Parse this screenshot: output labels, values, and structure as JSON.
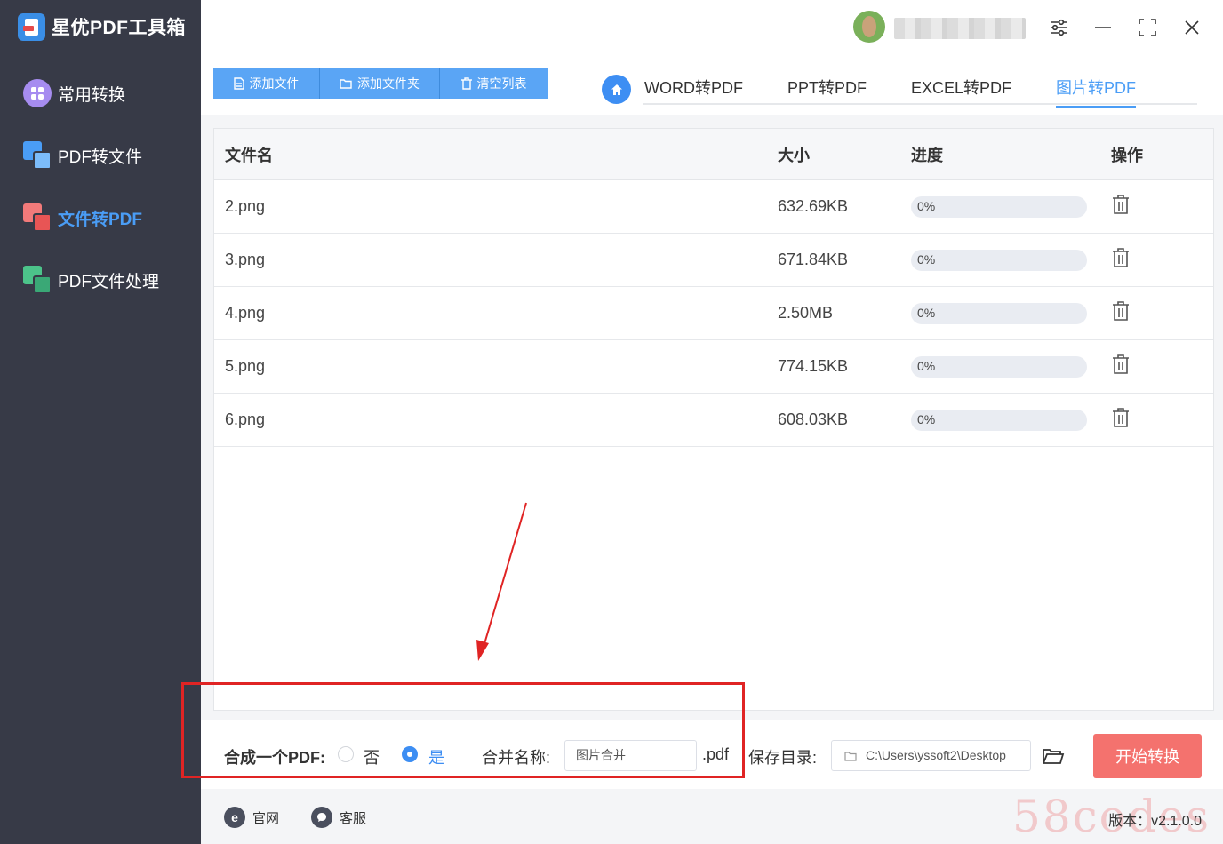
{
  "app": {
    "title": "星优PDF工具箱"
  },
  "sidebar": {
    "items": [
      {
        "label": "常用转换",
        "active": false
      },
      {
        "label": "PDF转文件",
        "active": false
      },
      {
        "label": "文件转PDF",
        "active": true
      },
      {
        "label": "PDF文件处理",
        "active": false
      }
    ]
  },
  "user": {
    "name": ""
  },
  "toolbar": {
    "add_file": "添加文件",
    "add_folder": "添加文件夹",
    "clear_list": "清空列表"
  },
  "tabs": [
    {
      "label": "WORD转PDF",
      "active": false
    },
    {
      "label": "PPT转PDF",
      "active": false
    },
    {
      "label": "EXCEL转PDF",
      "active": false
    },
    {
      "label": "图片转PDF",
      "active": true
    }
  ],
  "table": {
    "headers": {
      "name": "文件名",
      "size": "大小",
      "progress": "进度",
      "action": "操作"
    },
    "rows": [
      {
        "name": "2.png",
        "size": "632.69KB",
        "progress": "0%",
        "progress_value": 0
      },
      {
        "name": "3.png",
        "size": "671.84KB",
        "progress": "0%",
        "progress_value": 0
      },
      {
        "name": "4.png",
        "size": "2.50MB",
        "progress": "0%",
        "progress_value": 0
      },
      {
        "name": "5.png",
        "size": "774.15KB",
        "progress": "0%",
        "progress_value": 0
      },
      {
        "name": "6.png",
        "size": "608.03KB",
        "progress": "0%",
        "progress_value": 0
      }
    ]
  },
  "options": {
    "merge_label": "合成一个PDF:",
    "no_label": "否",
    "yes_label": "是",
    "merge_selected": "是",
    "merge_name_label": "合并名称:",
    "merge_name_value": "图片合并",
    "ext": ".pdf",
    "save_dir_label": "保存目录:",
    "save_dir_value": "C:\\Users\\yssoft2\\Desktop",
    "start_label": "开始转换"
  },
  "footer": {
    "website": "官网",
    "support": "客服",
    "version": "版本：v2.1.0.0",
    "watermark": "58codes"
  },
  "colors": {
    "sidebar_bg": "#373a47",
    "accent": "#4a9df6",
    "button": "#5aa5f5",
    "start_button": "#f4726e",
    "annotation": "#e02424"
  }
}
